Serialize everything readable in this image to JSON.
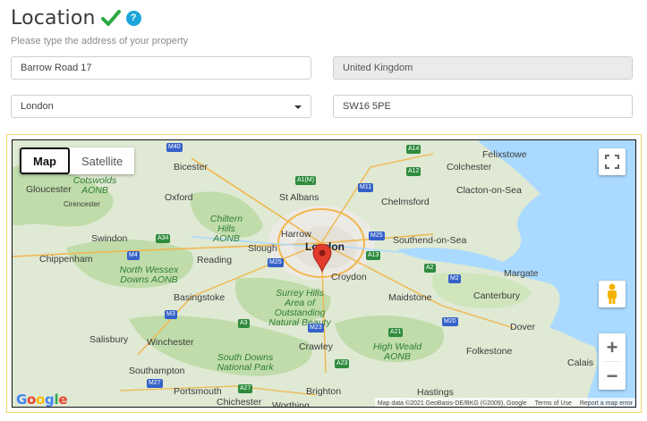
{
  "header": {
    "title": "Location",
    "help_label": "?"
  },
  "subtitle": "Please type the address of your property",
  "form": {
    "street": "Barrow Road 17",
    "country": "United Kingdom",
    "city": "London",
    "postcode": "SW16 5PE"
  },
  "map": {
    "type_buttons": {
      "map": "Map",
      "satellite": "Satellite"
    },
    "zoom_in": "+",
    "zoom_out": "−",
    "google_logo": "Google",
    "attribution": {
      "data": "Map data ©2021 GeoBasis-DE/BKG (©2009), Google",
      "terms": "Terms of Use",
      "report": "Report a map error"
    },
    "places": {
      "felixstowe": "Felixstowe",
      "colchester": "Colchester",
      "clacton": "Clacton-on-Sea",
      "chelmsford": "Chelmsford",
      "southend": "Southend-on-Sea",
      "london": "London",
      "croydon": "Croydon",
      "harrow": "Harrow",
      "slough": "Slough",
      "st_albans": "St Albans",
      "bicester": "Bicester",
      "oxford": "Oxford",
      "gloucester": "Gloucester",
      "cirencester": "Cirencester",
      "swindon": "Swindon",
      "chippenham": "Chippenham",
      "reading": "Reading",
      "basingstoke": "Basingstoke",
      "salisbury": "Salisbury",
      "winchester": "Winchester",
      "southampton": "Southampton",
      "portsmouth": "Portsmouth",
      "chichester": "Chichester",
      "worthing": "Worthing",
      "brighton": "Brighton",
      "hastings": "Hastings",
      "crawley": "Crawley",
      "maidstone": "Maidstone",
      "canterbury": "Canterbury",
      "margate": "Margate",
      "dover": "Dover",
      "folkestone": "Folkestone",
      "calais": "Calais",
      "cotswolds": "Cotswolds AONB",
      "chiltern": "Chiltern Hills AONB",
      "north_wessex": "North Wessex Downs AONB",
      "surrey_hills": "Surrey Hills Area of Outstanding Natural Beauty",
      "south_downs": "South Downs National Park",
      "high_weald": "High Weald AONB"
    },
    "roads": [
      "M40",
      "A1(M)",
      "M11",
      "M25",
      "M25",
      "A13",
      "M4",
      "M3",
      "A21",
      "A23",
      "M20",
      "M2",
      "M27",
      "A27",
      "A34",
      "A3",
      "M23",
      "A2",
      "A12",
      "A14"
    ]
  },
  "colors": {
    "accent_green": "#2ca843",
    "help_blue": "#1ba5d8",
    "map_border": "#f0d36b",
    "pin": "#e03b2c"
  }
}
